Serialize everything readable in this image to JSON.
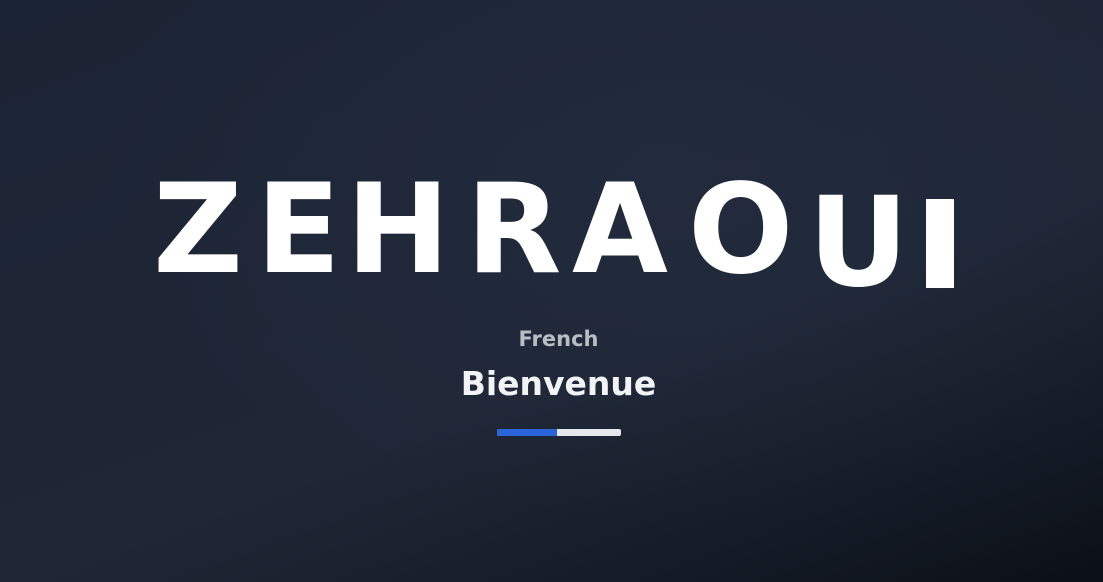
{
  "brand": {
    "letters": [
      "Z",
      "E",
      "H",
      "R",
      "A",
      "O",
      "U"
    ]
  },
  "language": {
    "name": "French",
    "greeting": "Bienvenue"
  },
  "progress": {
    "fraction": 0.48,
    "fill_color": "#2b63d9",
    "track_color": "#e6e7ea"
  },
  "colors": {
    "background": "#1e2636",
    "text": "#ffffff",
    "label": "#b9bdc4"
  }
}
